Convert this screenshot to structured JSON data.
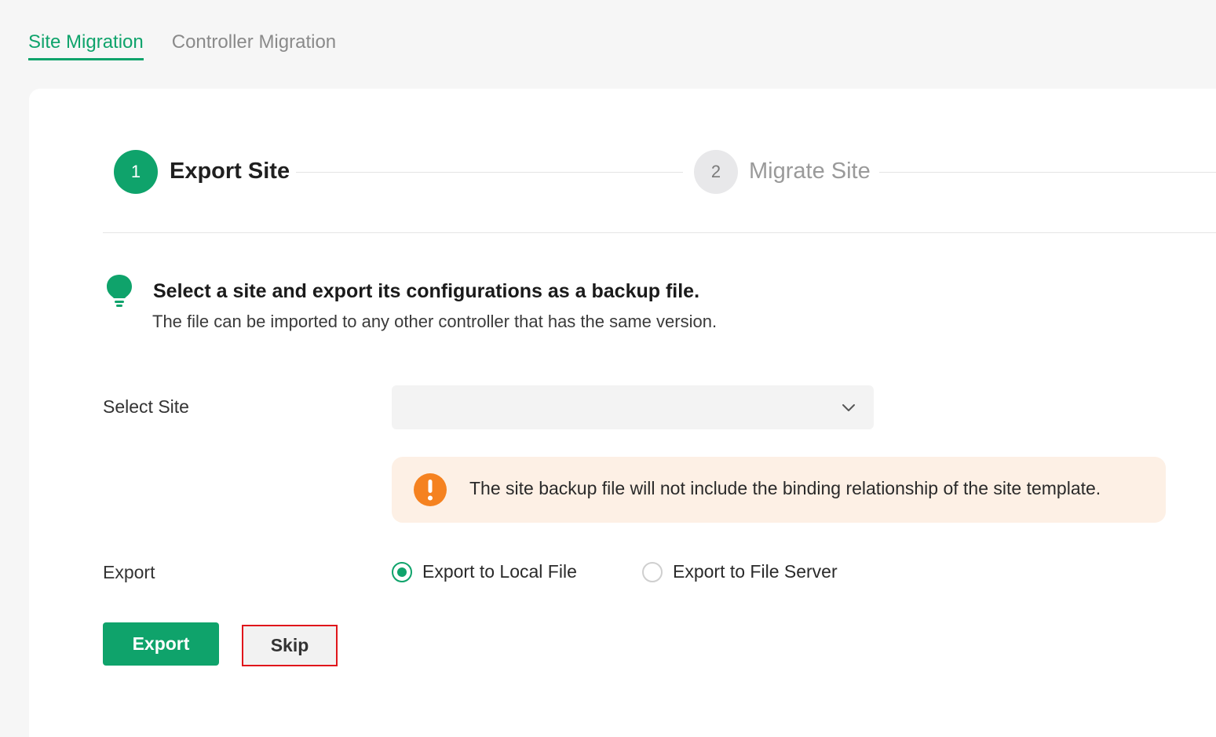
{
  "tabs": [
    {
      "label": "Site Migration",
      "active": true
    },
    {
      "label": "Controller Migration",
      "active": false
    }
  ],
  "stepper": {
    "step1": {
      "number": "1",
      "label": "Export Site",
      "state": "active"
    },
    "step2": {
      "number": "2",
      "label": "Migrate Site",
      "state": "pending"
    }
  },
  "hint": {
    "icon": "lightbulb-icon",
    "title": "Select a site and export its configurations as a backup file.",
    "subtitle": "The file can be imported to any other controller that has the same version."
  },
  "select_site": {
    "label": "Select Site",
    "value": ""
  },
  "warning": {
    "icon": "exclamation-icon",
    "text": "The site backup file will not include the binding relationship of the site template."
  },
  "export_options": {
    "label": "Export",
    "options": [
      {
        "label": "Export to Local File",
        "checked": true
      },
      {
        "label": "Export to File Server",
        "checked": false
      }
    ]
  },
  "actions": {
    "export_label": "Export",
    "skip_label": "Skip"
  },
  "colors": {
    "accent": "#0fa36b",
    "warning_bg": "#fdf0e5",
    "warning_icon": "#f58220",
    "highlight_border": "#e0161b"
  }
}
